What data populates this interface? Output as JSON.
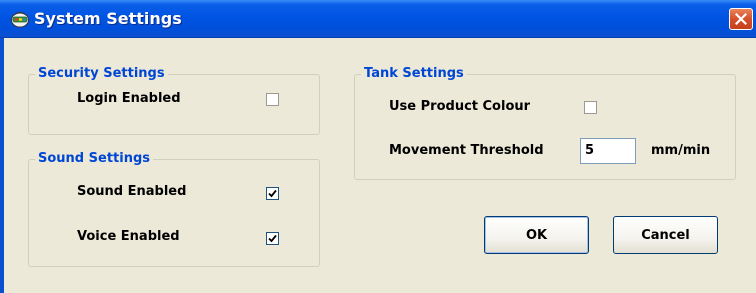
{
  "window": {
    "title": "System Settings",
    "title_bar_color": "#0054E3",
    "close_icon": "close-x-icon",
    "app_icon": "settings-app-icon"
  },
  "security": {
    "legend": "Security Settings",
    "login_label": "Login Enabled",
    "login_enabled": false
  },
  "sound": {
    "legend": "Sound Settings",
    "sound_label": "Sound Enabled",
    "sound_enabled": true,
    "voice_label": "Voice Enabled",
    "voice_enabled": true
  },
  "tank": {
    "legend": "Tank Settings",
    "product_colour_label": "Use Product Colour",
    "product_colour_enabled": false,
    "threshold_label": "Movement Threshold",
    "threshold_value": "5",
    "threshold_unit": "mm/min"
  },
  "buttons": {
    "ok": "OK",
    "cancel": "Cancel"
  },
  "colors": {
    "accent": "#0046D5",
    "background": "#ECE9D8"
  }
}
